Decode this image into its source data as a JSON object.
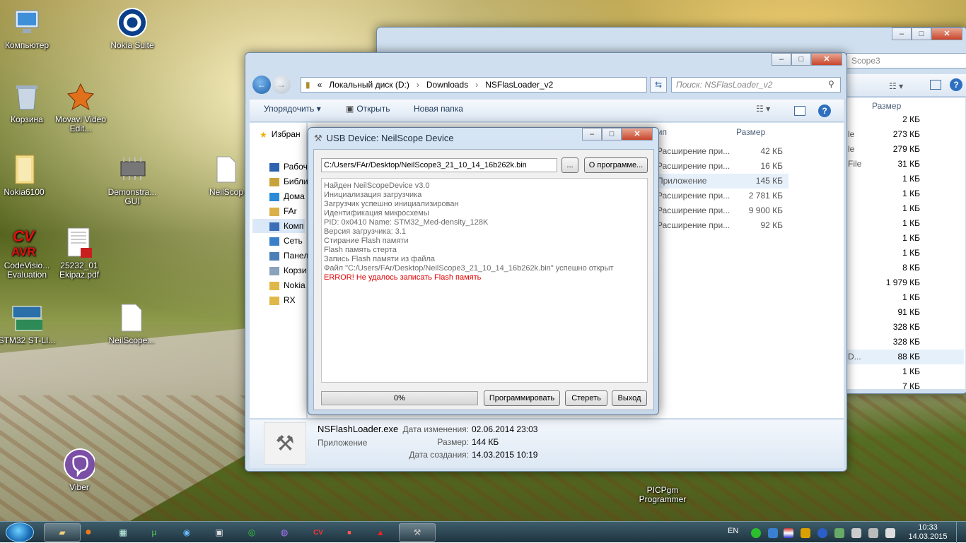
{
  "desktop": {
    "icons": [
      {
        "label": "Компьютер",
        "icon": "computer-icon"
      },
      {
        "label": "Nokia Suite",
        "icon": "nokia-suite-icon"
      },
      {
        "label": "Корзина",
        "icon": "recycle-bin-icon"
      },
      {
        "label": "Movavi Video Edit...",
        "icon": "movavi-icon"
      },
      {
        "label": "Nokia6100",
        "icon": "folder-icon"
      },
      {
        "label": "Demonstra... GUI",
        "icon": "chip-icon"
      },
      {
        "label": "NeilScop",
        "icon": "file-icon"
      },
      {
        "label": "CodeVisio... Evaluation",
        "icon": "cvavr-icon"
      },
      {
        "label": "25232_01 Ekipaz.pdf",
        "icon": "pdf-icon"
      },
      {
        "label": "STM32 ST-LI...",
        "icon": "stlink-icon"
      },
      {
        "label": "NeilScope...",
        "icon": "file-icon"
      },
      {
        "label": "Viber",
        "icon": "viber-icon"
      },
      {
        "label": "PICPgm Programmer",
        "icon": "picpgm-icon"
      }
    ]
  },
  "back_window": {
    "address_tail": "Scope3",
    "column_size": "Размер",
    "rows": [
      {
        "type": "",
        "size": "2 КБ"
      },
      {
        "type": "le",
        "size": "273 КБ"
      },
      {
        "type": "le",
        "size": "279 КБ"
      },
      {
        "type": "File",
        "size": "31 КБ"
      },
      {
        "type": "",
        "size": "1 КБ"
      },
      {
        "type": "",
        "size": "1 КБ"
      },
      {
        "type": "",
        "size": "1 КБ"
      },
      {
        "type": "",
        "size": "1 КБ"
      },
      {
        "type": "",
        "size": "1 КБ"
      },
      {
        "type": "",
        "size": "1 КБ"
      },
      {
        "type": "",
        "size": "8 КБ"
      },
      {
        "type": "",
        "size": "1 979 КБ"
      },
      {
        "type": "",
        "size": "1 КБ"
      },
      {
        "type": "",
        "size": "91 КБ"
      },
      {
        "type": "",
        "size": "328 КБ"
      },
      {
        "type": "",
        "size": "328 КБ"
      },
      {
        "type": "D...",
        "size": "88 КБ"
      },
      {
        "type": "",
        "size": "1 КБ"
      },
      {
        "type": "",
        "size": "7 КБ"
      }
    ]
  },
  "explorer": {
    "breadcrumb": [
      "«",
      "Локальный диск (D:)",
      "Downloads",
      "NSFlasLoader_v2"
    ],
    "search_placeholder": "Поиск: NSFlasLoader_v2",
    "toolbar": {
      "organize": "Упорядочить",
      "open": "Открыть",
      "new_folder": "Новая папка"
    },
    "nav": [
      {
        "label": "Избран",
        "icon": "star-icon"
      },
      {
        "label": "Рабочи",
        "icon": "desktop-icon"
      },
      {
        "label": "Библи",
        "icon": "library-icon"
      },
      {
        "label": "Дома",
        "icon": "homegroup-icon"
      },
      {
        "label": "FAr",
        "icon": "user-folder-icon"
      },
      {
        "label": "Комп",
        "icon": "computer-icon"
      },
      {
        "label": "Сеть",
        "icon": "network-icon"
      },
      {
        "label": "Панел",
        "icon": "control-panel-icon"
      },
      {
        "label": "Корзи",
        "icon": "recycle-bin-icon"
      },
      {
        "label": "Nokia",
        "icon": "folder-icon"
      },
      {
        "label": "RX",
        "icon": "folder-icon"
      }
    ],
    "columns": {
      "type": "Тип",
      "size": "Размер"
    },
    "files": [
      {
        "type": "Расширение при...",
        "size": "42 КБ"
      },
      {
        "type": "Расширение при...",
        "size": "16 КБ"
      },
      {
        "type": "Приложение",
        "size": "145 КБ"
      },
      {
        "type": "Расширение при...",
        "size": "2 781 КБ"
      },
      {
        "type": "Расширение при...",
        "size": "9 900 КБ"
      },
      {
        "type": "Расширение при...",
        "size": "92 КБ"
      }
    ],
    "details": {
      "name": "NSFlashLoader.exe",
      "kind": "Приложение",
      "modified_label": "Дата изменения:",
      "modified": "02.06.2014 23:03",
      "size_label": "Размер:",
      "size": "144 КБ",
      "created_label": "Дата создания:",
      "created": "14.03.2015 10:19"
    }
  },
  "dialog": {
    "title": "USB Device: NeilScope Device",
    "file_path": "C:/Users/FAr/Desktop/NeilScope3_21_10_14_16b262k.bin",
    "browse": "...",
    "about": "О программе...",
    "log": [
      "Найден NeilScopeDevice v3.0",
      "Инициализация загрузчика",
      "Загрузчик успешно инициализирован",
      "Идентификация микросхемы",
      "PID: 0x0410 Name: STM32_Med-density_128K",
      "Версия загрузчика: 3.1",
      "Стирание Flash памяти",
      "Flash память стерта",
      "Запись Flash памяти из файла",
      "Файл \"C:/Users/FAr/Desktop/NeilScope3_21_10_14_16b262k.bin\" успешно открыт"
    ],
    "error": "ERROR! Не удалось записать Flash память",
    "progress_text": "0%",
    "progress": 0,
    "program": "Программировать",
    "erase": "Стереть",
    "exit": "Выход"
  },
  "taskbar": {
    "lang": "EN",
    "time": "10:33",
    "date": "14.03.2015"
  },
  "colors": {
    "error": "#e00000",
    "log_text": "#6a6a6a",
    "link": "#1e395b"
  }
}
